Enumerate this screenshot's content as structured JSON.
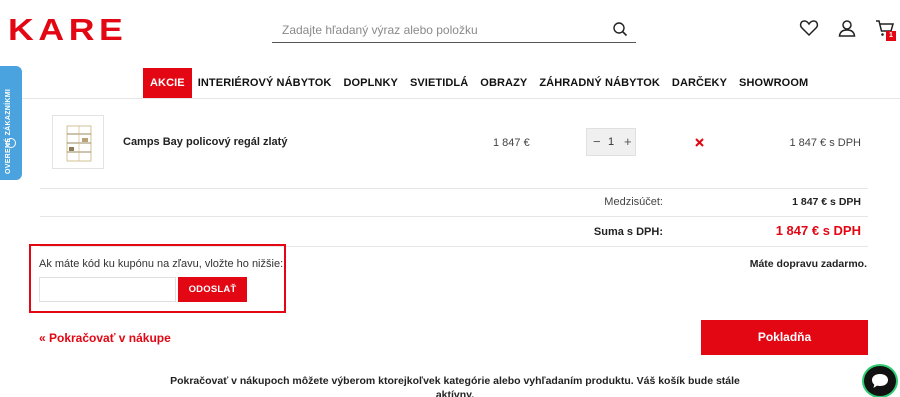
{
  "header": {
    "logo": "KARE",
    "search_placeholder": "Zadajte hľadaný výraz alebo položku",
    "cart_count": "1",
    "icons": [
      "search-icon",
      "heart-icon",
      "user-icon",
      "cart-icon"
    ]
  },
  "nav": {
    "items": [
      "AKCIE",
      "INTERIÉROVÝ NÁBYTOK",
      "DOPLNKY",
      "SVIETIDLÁ",
      "OBRAZY",
      "ZÁHRADNÝ NÁBYTOK",
      "DARČEKY",
      "SHOWROOM"
    ],
    "active": "AKCIE"
  },
  "side_tab": {
    "label": "OVERENÉ ZÁKAZNÍKMI"
  },
  "cart": {
    "item": {
      "name": "Camps Bay policový regál zlatý",
      "price": "1 847 €",
      "quantity": "1",
      "qty_minus": "−",
      "qty_plus": "+",
      "total": "1 847 € s DPH"
    },
    "subtotal_label": "Medzisúčet:",
    "subtotal_value": "1 847 € s DPH",
    "sum_label": "Suma s DPH:",
    "sum_value": "1 847 € s DPH"
  },
  "coupon": {
    "prompt": "Ak máte kód ku kupónu na zľavu, vložte ho nižšie:",
    "input_value": "",
    "submit_label": "ODOSLAŤ"
  },
  "shipping_note": "Máte dopravu zadarmo.",
  "continue_label": "« Pokračovať v nákupe",
  "checkout_label": "Pokladňa",
  "info_text": "Pokračovať v nákupoch môžete výberom ktorejkoľvek kategórie alebo vyhľadaním produktu. Váš košík bude stále aktívny.",
  "colors": {
    "brand": "#e30613",
    "side_tab": "#4aa3df"
  }
}
